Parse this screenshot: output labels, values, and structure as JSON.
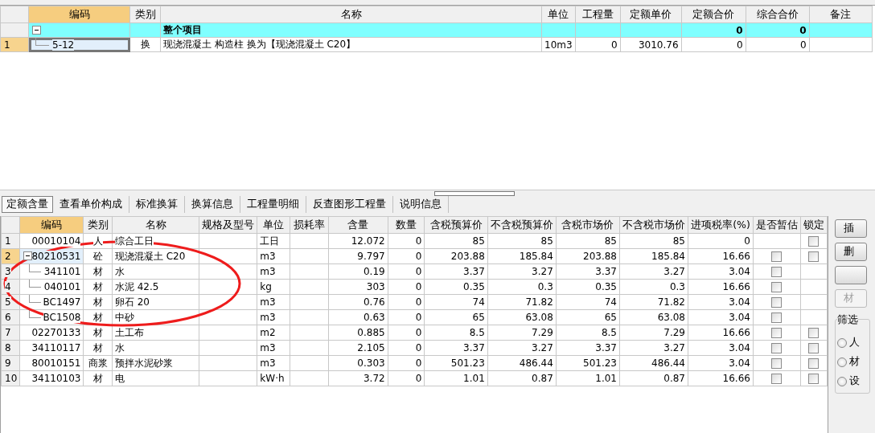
{
  "top_grid": {
    "columns": [
      "编码",
      "类别",
      "名称",
      "单位",
      "工程量",
      "定额单价",
      "定额合价",
      "综合合价",
      "备注"
    ],
    "rows": [
      {
        "name": "整个项目",
        "quota_total": "0",
        "total": "0",
        "expanded": true,
        "children": [
          {
            "no": "1",
            "code": "5-12",
            "type": "换",
            "name": "现浇混凝土  构造柱  换为【现浇混凝土 C20】",
            "unit": "10m3",
            "qty": "0",
            "unit_price": "3010.76",
            "quota_total": "0",
            "total": "0",
            "selected": true
          }
        ]
      }
    ]
  },
  "tabs": [
    {
      "label": "定额含量",
      "selected": true
    },
    {
      "label": "查看单价构成",
      "selected": false
    },
    {
      "label": "标准换算",
      "selected": false
    },
    {
      "label": "换算信息",
      "selected": false
    },
    {
      "label": "工程量明细",
      "selected": false
    },
    {
      "label": "反查图形工程量",
      "selected": false
    },
    {
      "label": "说明信息",
      "selected": false
    }
  ],
  "bottom_grid": {
    "columns": [
      "编码",
      "类别",
      "名称",
      "规格及型号",
      "单位",
      "损耗率",
      "含量",
      "数量",
      "含税预算价",
      "不含税预算价",
      "含税市场价",
      "不含税市场价",
      "进项税率(%)",
      "是否暂估",
      "锁定"
    ],
    "rows": [
      {
        "no": "1",
        "code": "00010104",
        "type": "人",
        "name": "综合工日",
        "unit": "工日",
        "content": "12.072",
        "qty": "0",
        "tax_budget": "85",
        "notax_budget": "85",
        "tax_market": "85",
        "notax_market": "85",
        "tax_rate": "0",
        "locked": false,
        "selected": false
      },
      {
        "no": "2",
        "code": "80210531",
        "type": "砼",
        "name": "现浇混凝土 C20",
        "unit": "m3",
        "content": "9.797",
        "qty": "0",
        "tax_budget": "203.88",
        "notax_budget": "185.84",
        "tax_market": "203.88",
        "notax_market": "185.84",
        "tax_rate": "16.66",
        "estimated": false,
        "locked": false,
        "selected": true,
        "expanded": true,
        "children": [
          {
            "no": "3",
            "code": "341101",
            "type": "材",
            "name": "水",
            "unit": "m3",
            "content": "0.19",
            "qty": "0",
            "tax_budget": "3.37",
            "notax_budget": "3.27",
            "tax_market": "3.37",
            "notax_market": "3.27",
            "tax_rate": "3.04",
            "estimated": false,
            "selected": false
          },
          {
            "no": "4",
            "code": "040101",
            "type": "材",
            "name": "水泥 42.5",
            "unit": "kg",
            "content": "303",
            "qty": "0",
            "tax_budget": "0.35",
            "notax_budget": "0.3",
            "tax_market": "0.35",
            "notax_market": "0.3",
            "tax_rate": "16.66",
            "estimated": false,
            "selected": false
          },
          {
            "no": "5",
            "code": "BC1497",
            "type": "材",
            "name": "卵石 20",
            "unit": "m3",
            "content": "0.76",
            "qty": "0",
            "tax_budget": "74",
            "notax_budget": "71.82",
            "tax_market": "74",
            "notax_market": "71.82",
            "tax_rate": "3.04",
            "estimated": false,
            "selected": false
          },
          {
            "no": "6",
            "code": "BC1508",
            "type": "材",
            "name": "中砂",
            "unit": "m3",
            "content": "0.63",
            "qty": "0",
            "tax_budget": "65",
            "notax_budget": "63.08",
            "tax_market": "65",
            "notax_market": "63.08",
            "tax_rate": "3.04",
            "estimated": false,
            "selected": false
          }
        ]
      },
      {
        "no": "7",
        "code": "02270133",
        "type": "材",
        "name": "土工布",
        "unit": "m2",
        "content": "0.885",
        "qty": "0",
        "tax_budget": "8.5",
        "notax_budget": "7.29",
        "tax_market": "8.5",
        "notax_market": "7.29",
        "tax_rate": "16.66",
        "estimated": false,
        "locked": false,
        "selected": false
      },
      {
        "no": "8",
        "code": "34110117",
        "type": "材",
        "name": "水",
        "unit": "m3",
        "content": "2.105",
        "qty": "0",
        "tax_budget": "3.37",
        "notax_budget": "3.27",
        "tax_market": "3.37",
        "notax_market": "3.27",
        "tax_rate": "3.04",
        "estimated": false,
        "locked": false,
        "selected": false
      },
      {
        "no": "9",
        "code": "80010151",
        "type": "商浆",
        "name": "预拌水泥砂浆",
        "unit": "m3",
        "content": "0.303",
        "qty": "0",
        "tax_budget": "501.23",
        "notax_budget": "486.44",
        "tax_market": "501.23",
        "notax_market": "486.44",
        "tax_rate": "3.04",
        "estimated": false,
        "locked": false,
        "selected": false
      },
      {
        "no": "10",
        "code": "34110103",
        "type": "材",
        "name": "电",
        "unit": "kW·h",
        "content": "3.72",
        "qty": "0",
        "tax_budget": "1.01",
        "notax_budget": "0.87",
        "tax_market": "1.01",
        "notax_market": "0.87",
        "tax_rate": "16.66",
        "estimated": false,
        "locked": false,
        "selected": false
      }
    ]
  },
  "side_panel": {
    "buttons": [
      {
        "label": "插",
        "disabled": false
      },
      {
        "label": "删",
        "disabled": false
      },
      {
        "disabled": false
      },
      {
        "label": "材",
        "disabled": true
      }
    ],
    "filter": {
      "title": "筛选",
      "options": [
        {
          "label": "人",
          "selected": false
        },
        {
          "label": "材",
          "selected": false
        },
        {
          "label": "设",
          "selected": false
        }
      ]
    }
  },
  "annotation": {
    "kind": "ellipse"
  }
}
